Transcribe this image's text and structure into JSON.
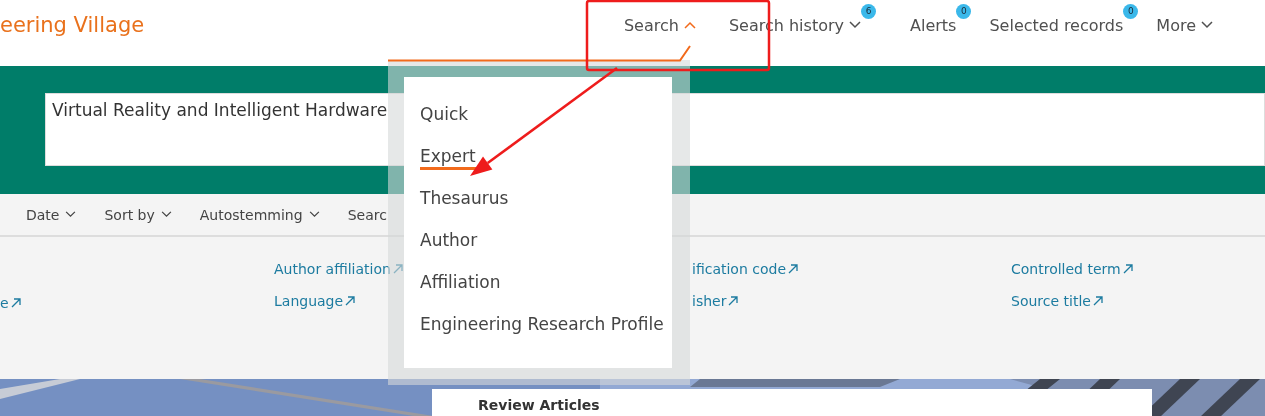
{
  "logo": "eering Village",
  "nav": [
    {
      "label": "Search",
      "kind": "dropdown",
      "expanded": true
    },
    {
      "label": "Search history",
      "kind": "dropdown",
      "badge": "6",
      "expanded": false
    },
    {
      "label": "Alerts",
      "kind": "link",
      "badge": "0"
    },
    {
      "label": "Selected records",
      "kind": "link",
      "badge": "0"
    },
    {
      "label": "More",
      "kind": "dropdown",
      "expanded": false
    }
  ],
  "search_field": {
    "value": "Virtual Reality and Intelligent Hardware"
  },
  "toolbar": [
    {
      "label": "Date",
      "kind": "dropdown"
    },
    {
      "label": "Sort by",
      "kind": "dropdown"
    },
    {
      "label": "Autostemming",
      "kind": "dropdown"
    },
    {
      "label": "Searc",
      "kind": "cut"
    }
  ],
  "link_columns": [
    {
      "kind": "lower",
      "links": [
        "e"
      ]
    },
    {
      "kind": "full",
      "links": [
        "Author affiliation",
        "Language"
      ]
    },
    {
      "kind": "full",
      "links": [
        "ification code",
        "isher"
      ]
    },
    {
      "kind": "full",
      "links": [
        "Controlled term",
        "Source title"
      ]
    }
  ],
  "featured_card": {
    "title": "Review Articles"
  },
  "search_menu": [
    {
      "label": "Quick",
      "selected": false
    },
    {
      "label": "Expert",
      "selected": true
    },
    {
      "label": "Thesaurus",
      "selected": false
    },
    {
      "label": "Author",
      "selected": false
    },
    {
      "label": "Affiliation",
      "selected": false
    },
    {
      "label": "Engineering Research Profile",
      "selected": false
    }
  ]
}
